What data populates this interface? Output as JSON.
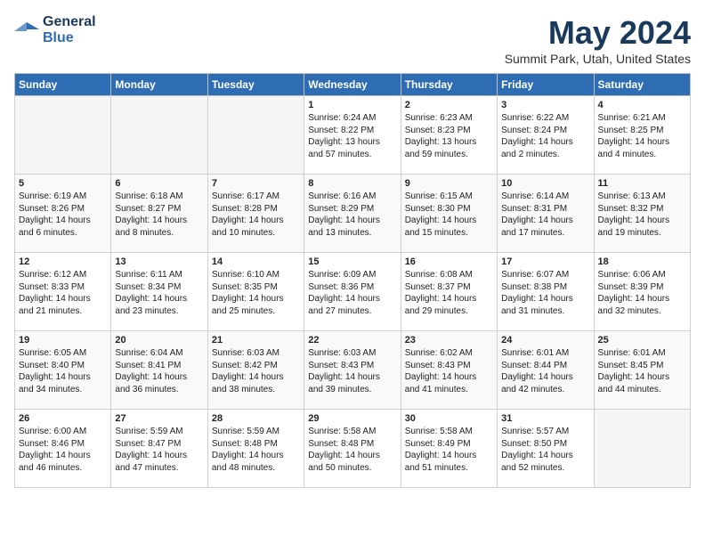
{
  "header": {
    "logo_line1": "General",
    "logo_line2": "Blue",
    "month": "May 2024",
    "location": "Summit Park, Utah, United States"
  },
  "days_of_week": [
    "Sunday",
    "Monday",
    "Tuesday",
    "Wednesday",
    "Thursday",
    "Friday",
    "Saturday"
  ],
  "weeks": [
    [
      {
        "day": null
      },
      {
        "day": null
      },
      {
        "day": null
      },
      {
        "day": "1",
        "sunrise": "Sunrise: 6:24 AM",
        "sunset": "Sunset: 8:22 PM",
        "daylight": "Daylight: 13 hours and 57 minutes."
      },
      {
        "day": "2",
        "sunrise": "Sunrise: 6:23 AM",
        "sunset": "Sunset: 8:23 PM",
        "daylight": "Daylight: 13 hours and 59 minutes."
      },
      {
        "day": "3",
        "sunrise": "Sunrise: 6:22 AM",
        "sunset": "Sunset: 8:24 PM",
        "daylight": "Daylight: 14 hours and 2 minutes."
      },
      {
        "day": "4",
        "sunrise": "Sunrise: 6:21 AM",
        "sunset": "Sunset: 8:25 PM",
        "daylight": "Daylight: 14 hours and 4 minutes."
      }
    ],
    [
      {
        "day": "5",
        "sunrise": "Sunrise: 6:19 AM",
        "sunset": "Sunset: 8:26 PM",
        "daylight": "Daylight: 14 hours and 6 minutes."
      },
      {
        "day": "6",
        "sunrise": "Sunrise: 6:18 AM",
        "sunset": "Sunset: 8:27 PM",
        "daylight": "Daylight: 14 hours and 8 minutes."
      },
      {
        "day": "7",
        "sunrise": "Sunrise: 6:17 AM",
        "sunset": "Sunset: 8:28 PM",
        "daylight": "Daylight: 14 hours and 10 minutes."
      },
      {
        "day": "8",
        "sunrise": "Sunrise: 6:16 AM",
        "sunset": "Sunset: 8:29 PM",
        "daylight": "Daylight: 14 hours and 13 minutes."
      },
      {
        "day": "9",
        "sunrise": "Sunrise: 6:15 AM",
        "sunset": "Sunset: 8:30 PM",
        "daylight": "Daylight: 14 hours and 15 minutes."
      },
      {
        "day": "10",
        "sunrise": "Sunrise: 6:14 AM",
        "sunset": "Sunset: 8:31 PM",
        "daylight": "Daylight: 14 hours and 17 minutes."
      },
      {
        "day": "11",
        "sunrise": "Sunrise: 6:13 AM",
        "sunset": "Sunset: 8:32 PM",
        "daylight": "Daylight: 14 hours and 19 minutes."
      }
    ],
    [
      {
        "day": "12",
        "sunrise": "Sunrise: 6:12 AM",
        "sunset": "Sunset: 8:33 PM",
        "daylight": "Daylight: 14 hours and 21 minutes."
      },
      {
        "day": "13",
        "sunrise": "Sunrise: 6:11 AM",
        "sunset": "Sunset: 8:34 PM",
        "daylight": "Daylight: 14 hours and 23 minutes."
      },
      {
        "day": "14",
        "sunrise": "Sunrise: 6:10 AM",
        "sunset": "Sunset: 8:35 PM",
        "daylight": "Daylight: 14 hours and 25 minutes."
      },
      {
        "day": "15",
        "sunrise": "Sunrise: 6:09 AM",
        "sunset": "Sunset: 8:36 PM",
        "daylight": "Daylight: 14 hours and 27 minutes."
      },
      {
        "day": "16",
        "sunrise": "Sunrise: 6:08 AM",
        "sunset": "Sunset: 8:37 PM",
        "daylight": "Daylight: 14 hours and 29 minutes."
      },
      {
        "day": "17",
        "sunrise": "Sunrise: 6:07 AM",
        "sunset": "Sunset: 8:38 PM",
        "daylight": "Daylight: 14 hours and 31 minutes."
      },
      {
        "day": "18",
        "sunrise": "Sunrise: 6:06 AM",
        "sunset": "Sunset: 8:39 PM",
        "daylight": "Daylight: 14 hours and 32 minutes."
      }
    ],
    [
      {
        "day": "19",
        "sunrise": "Sunrise: 6:05 AM",
        "sunset": "Sunset: 8:40 PM",
        "daylight": "Daylight: 14 hours and 34 minutes."
      },
      {
        "day": "20",
        "sunrise": "Sunrise: 6:04 AM",
        "sunset": "Sunset: 8:41 PM",
        "daylight": "Daylight: 14 hours and 36 minutes."
      },
      {
        "day": "21",
        "sunrise": "Sunrise: 6:03 AM",
        "sunset": "Sunset: 8:42 PM",
        "daylight": "Daylight: 14 hours and 38 minutes."
      },
      {
        "day": "22",
        "sunrise": "Sunrise: 6:03 AM",
        "sunset": "Sunset: 8:43 PM",
        "daylight": "Daylight: 14 hours and 39 minutes."
      },
      {
        "day": "23",
        "sunrise": "Sunrise: 6:02 AM",
        "sunset": "Sunset: 8:43 PM",
        "daylight": "Daylight: 14 hours and 41 minutes."
      },
      {
        "day": "24",
        "sunrise": "Sunrise: 6:01 AM",
        "sunset": "Sunset: 8:44 PM",
        "daylight": "Daylight: 14 hours and 42 minutes."
      },
      {
        "day": "25",
        "sunrise": "Sunrise: 6:01 AM",
        "sunset": "Sunset: 8:45 PM",
        "daylight": "Daylight: 14 hours and 44 minutes."
      }
    ],
    [
      {
        "day": "26",
        "sunrise": "Sunrise: 6:00 AM",
        "sunset": "Sunset: 8:46 PM",
        "daylight": "Daylight: 14 hours and 46 minutes."
      },
      {
        "day": "27",
        "sunrise": "Sunrise: 5:59 AM",
        "sunset": "Sunset: 8:47 PM",
        "daylight": "Daylight: 14 hours and 47 minutes."
      },
      {
        "day": "28",
        "sunrise": "Sunrise: 5:59 AM",
        "sunset": "Sunset: 8:48 PM",
        "daylight": "Daylight: 14 hours and 48 minutes."
      },
      {
        "day": "29",
        "sunrise": "Sunrise: 5:58 AM",
        "sunset": "Sunset: 8:48 PM",
        "daylight": "Daylight: 14 hours and 50 minutes."
      },
      {
        "day": "30",
        "sunrise": "Sunrise: 5:58 AM",
        "sunset": "Sunset: 8:49 PM",
        "daylight": "Daylight: 14 hours and 51 minutes."
      },
      {
        "day": "31",
        "sunrise": "Sunrise: 5:57 AM",
        "sunset": "Sunset: 8:50 PM",
        "daylight": "Daylight: 14 hours and 52 minutes."
      },
      {
        "day": null
      }
    ]
  ]
}
